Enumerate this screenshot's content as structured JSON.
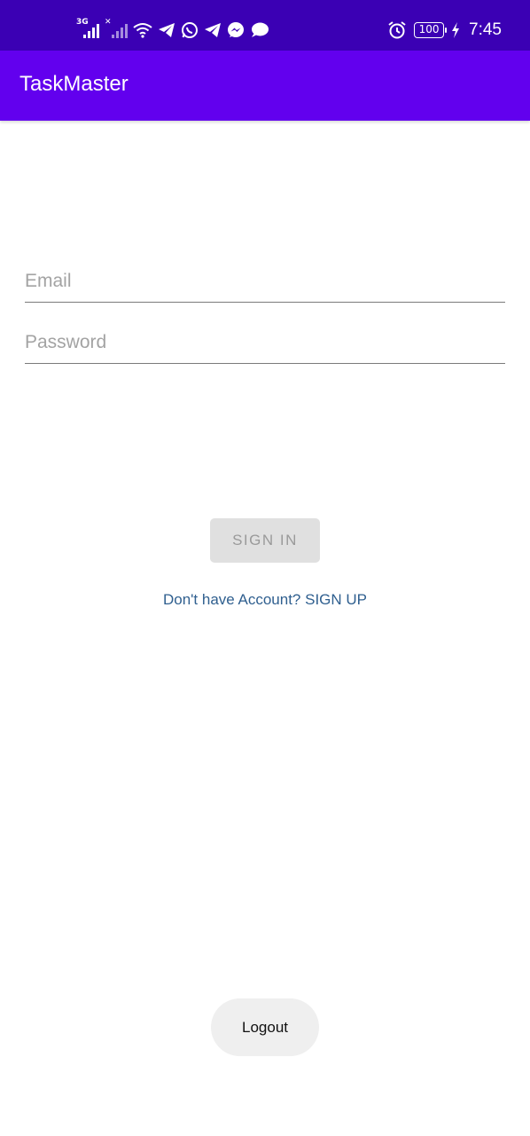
{
  "status_bar": {
    "network_label": "3G",
    "battery": "100",
    "time": "7:45"
  },
  "app_bar": {
    "title": "TaskMaster"
  },
  "form": {
    "email_placeholder": "Email",
    "email_value": "",
    "password_placeholder": "Password",
    "password_value": "",
    "signin_label": "SIGN IN",
    "signup_text": "Don't have Account? SIGN UP"
  },
  "logout_label": "Logout",
  "colors": {
    "status_bar": "#3b00b4",
    "app_bar": "#6200ee",
    "link": "#2f5f8f"
  }
}
